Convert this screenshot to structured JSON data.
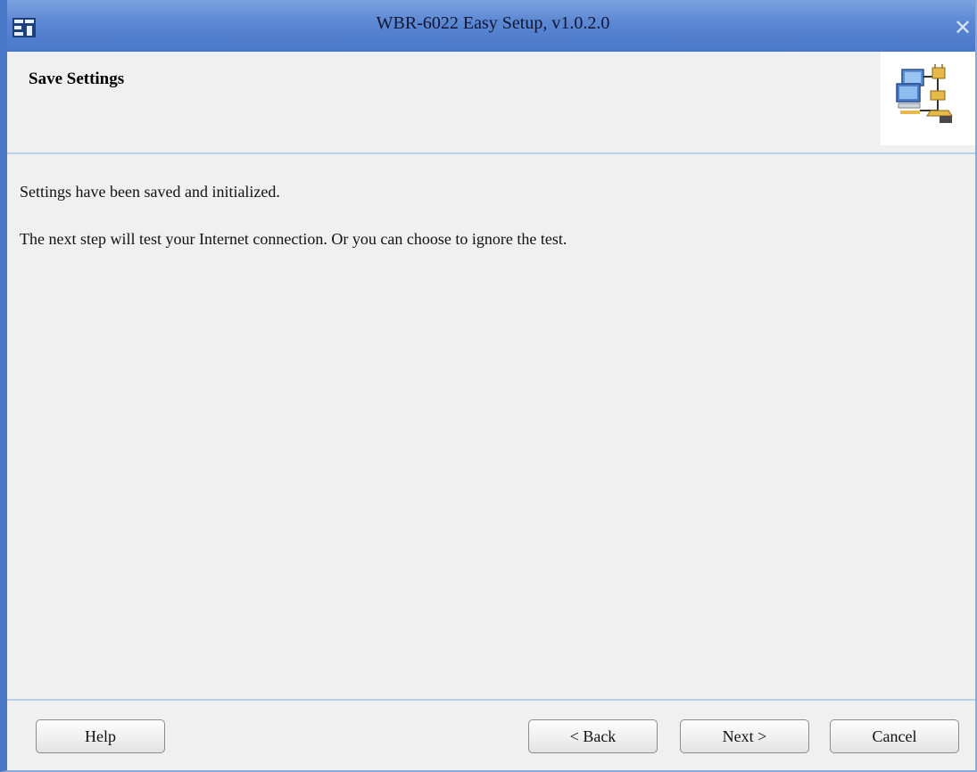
{
  "window": {
    "title": "WBR-6022 Easy Setup, v1.0.2.0",
    "close_symbol": "✕",
    "icons": {
      "app": "app-logo-icon",
      "close": "close-icon",
      "header": "network-computers-icon"
    }
  },
  "header": {
    "title": "Save Settings"
  },
  "content": {
    "line1": "Settings have been saved and initialized.",
    "line2": "The next step will test your Internet connection. Or you can choose to ignore the test."
  },
  "buttons": {
    "help": "Help",
    "back": "< Back",
    "next": "Next >",
    "cancel": "Cancel"
  },
  "colors": {
    "titlebar": "#4a78c8",
    "divider": "#b8cfe6",
    "background": "#f0f0f0"
  }
}
